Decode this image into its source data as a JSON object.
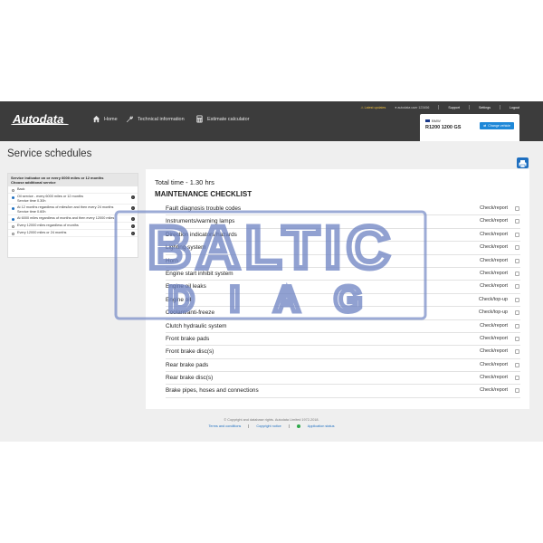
{
  "header": {
    "logo": "Autodata",
    "nav": [
      {
        "label": "Home",
        "icon": "home-icon"
      },
      {
        "label": "Technical information",
        "icon": "wrench-icon"
      },
      {
        "label": "Estimate calculator",
        "icon": "calculator-icon"
      }
    ],
    "top": {
      "latest_updates": "Latest updates",
      "user": "autodata user 123456",
      "support": "Support",
      "settings": "Settings",
      "logout": "Logout"
    },
    "vehicle": {
      "make": "BMW",
      "model": "R1200 1200 GS",
      "change_label": "Change vehicle"
    }
  },
  "page_title": "Service schedules",
  "print_icon": "print-icon",
  "left_panel": {
    "heading_line1": "Service indicator on or every 6000 miles or 12 months",
    "heading_line2": "Choose additional service",
    "options": [
      {
        "label": "Back",
        "sub": "",
        "selected": false,
        "info": false
      },
      {
        "label": "Oil service - every 6000 miles or 12 months",
        "sub": "Service time 0.30h",
        "selected": true,
        "info": true
      },
      {
        "label": "At 12 months regardless of miles/km and then every 24 months",
        "sub": "Service time 0.60h",
        "selected": true,
        "info": true
      },
      {
        "label": "At 6000 miles regardless of months and then every 12000 miles",
        "sub": "",
        "selected": true,
        "info": true
      },
      {
        "label": "Every 12000 miles regardless of months",
        "sub": "",
        "selected": false,
        "info": true
      },
      {
        "label": "Every 12000 miles or 24 months",
        "sub": "",
        "selected": false,
        "info": true
      }
    ]
  },
  "checklist": {
    "total_time": "Total time - 1.30 hrs",
    "title": "MAINTENANCE CHECKLIST",
    "items": [
      {
        "name": "Fault diagnosis trouble codes",
        "action": "Check/report"
      },
      {
        "name": "Instruments/warning lamps",
        "action": "Check/report"
      },
      {
        "name": "Direction indicators/hazards",
        "action": "Check/report"
      },
      {
        "name": "Lighting system",
        "action": "Check/report"
      },
      {
        "name": "Horn",
        "action": "Check/report"
      },
      {
        "name": "Engine start inhibit system",
        "action": "Check/report"
      },
      {
        "name": "Engine oil leaks",
        "action": "Check/report"
      },
      {
        "name": "Engine oil",
        "action": "Check/top-up"
      },
      {
        "name": "Coolant/anti-freeze",
        "action": "Check/top-up"
      },
      {
        "name": "Clutch hydraulic system",
        "action": "Check/report"
      },
      {
        "name": "Front brake pads",
        "action": "Check/report"
      },
      {
        "name": "Front brake disc(s)",
        "action": "Check/report"
      },
      {
        "name": "Rear brake pads",
        "action": "Check/report"
      },
      {
        "name": "Rear brake disc(s)",
        "action": "Check/report"
      },
      {
        "name": "Brake pipes, hoses and connections",
        "action": "Check/report"
      }
    ]
  },
  "footer": {
    "copyright": "© Copyright and database rights. Autodata Limited 1972-2018.",
    "terms": "Terms and conditions",
    "copyright_notice": "Copyright notice",
    "app_status": "Application status"
  },
  "watermark": {
    "line1": "BALTIC",
    "line2": "D I A G"
  },
  "colors": {
    "header_bg": "#3c3c3c",
    "accent": "#1e6fc0",
    "watermark": "#7b8fc8"
  }
}
